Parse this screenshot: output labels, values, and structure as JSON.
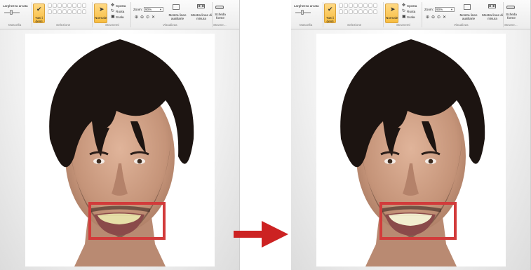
{
  "panels": [
    {
      "id": "before",
      "ribbon": {
        "width_label": "Larghezza arcata",
        "mascella_group": "Mascella",
        "all_teeth_label": "Tutti i denti",
        "selection_group": "Selezione",
        "normal_label": "Normale",
        "move_label": "Sposta",
        "rotate_label": "Ruota",
        "scale_label": "Scala",
        "tools_group": "Strumenti",
        "zoom_label": "Zoom:",
        "zoom_value": "90%",
        "guides_label": "Mostra linee ausiliarie",
        "measure_label": "Mostra linee di misura",
        "view_group": "Visualizza",
        "shapes_label": "Scheda forme",
        "tools_short_group": "Strume..."
      }
    },
    {
      "id": "after",
      "ribbon": {
        "width_label": "Larghezza arcata",
        "mascella_group": "Mascella",
        "all_teeth_label": "Tutti i denti",
        "selection_group": "Selezione",
        "normal_label": "Normale",
        "move_label": "Sposta",
        "rotate_label": "Ruota",
        "scale_label": "Scala",
        "tools_group": "Strumenti",
        "zoom_label": "Zoom:",
        "zoom_value": "90%",
        "guides_label": "Mostra linee ausiliarie",
        "measure_label": "Mostra linee di misura",
        "view_group": "Visualizza",
        "shapes_label": "Scheda forme",
        "tools_short_group": "Strume..."
      }
    }
  ],
  "colors": {
    "highlight": "#d23b3b",
    "active_button": "#f8bd3f",
    "arrow": "#cc2222",
    "hair": "#1c1411",
    "skin": "#c89a80"
  },
  "icons": [
    "checkmark-icon",
    "cursor-icon",
    "move-icon",
    "rotate-icon",
    "scale-icon",
    "zoom-in-icon",
    "zoom-out-icon",
    "zoom-fit-icon",
    "grid-icon",
    "ruler-icon",
    "shape-icon",
    "arrow-right-icon"
  ]
}
